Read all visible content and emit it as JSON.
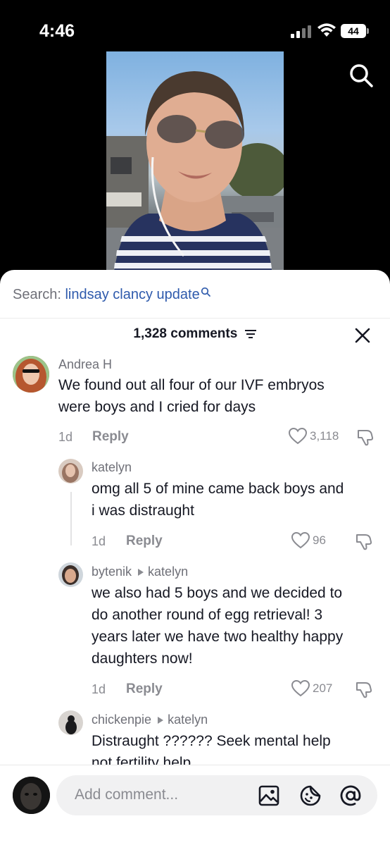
{
  "status_bar": {
    "time": "4:46",
    "battery": "44",
    "icons": [
      "cellular-signal-icon",
      "wifi-icon",
      "battery-icon"
    ]
  },
  "video": {
    "icons": [
      "search-icon"
    ]
  },
  "search": {
    "label": "Search: ",
    "query": "lindsay clancy update"
  },
  "comments_header": {
    "count_label": "1,328 comments",
    "icons": [
      "filter-icon",
      "close-icon"
    ]
  },
  "comments": [
    {
      "username": "Andrea H",
      "text_line1": "We found out all four of our IVF embryos",
      "text_line2": "were boys and I cried for days",
      "age": "1d",
      "reply_label": "Reply",
      "likes": "3,118"
    },
    {
      "username": "katelyn",
      "text_line1": "omg all 5 of mine came back boys and",
      "text_line2": "i was distraught",
      "age": "1d",
      "reply_label": "Reply",
      "likes": "96"
    },
    {
      "username": "bytenik",
      "reply_to": "katelyn",
      "text_line1": "we also had 5 boys and we decided to",
      "text_line2": "do another round of egg retrieval! 3",
      "text_line3": "years later we have two healthy happy",
      "text_line4": "daughters now!",
      "age": "1d",
      "reply_label": "Reply",
      "likes": "207"
    },
    {
      "username": "chickenpie",
      "reply_to": "katelyn",
      "text_line1": "Distraught ?????? Seek mental help",
      "text_line2": "not fertility help"
    }
  ],
  "composer": {
    "placeholder": "Add comment...",
    "icons": [
      "image-icon",
      "emoji-sticker-icon",
      "mention-icon"
    ]
  },
  "colors": {
    "query_blue": "#2e5aac",
    "text_primary": "#161823",
    "text_secondary": "#8a8b91"
  }
}
